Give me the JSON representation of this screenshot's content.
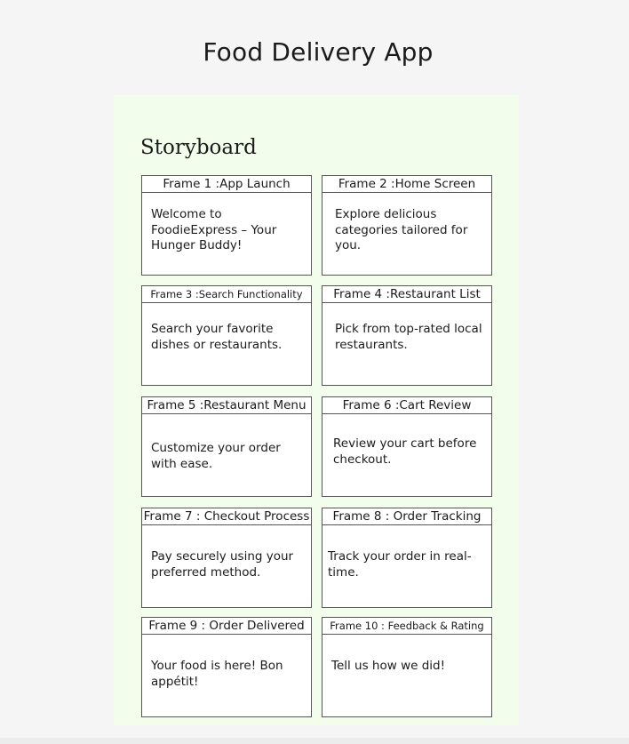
{
  "title": "Food Delivery App",
  "storyboard": {
    "heading": "Storyboard",
    "frames": [
      {
        "header": "Frame 1 :App Launch",
        "body": "Welcome to FoodieExpress – Your Hunger Buddy!"
      },
      {
        "header": "Frame 2 :Home Screen",
        "body": "Explore delicious categories tailored for you."
      },
      {
        "header": "Frame 3 :Search Functionality",
        "body": "Search your favorite dishes or restaurants."
      },
      {
        "header": "Frame 4 :Restaurant List",
        "body": "Pick from top-rated local restaurants."
      },
      {
        "header": "Frame 5 :Restaurant Menu",
        "body": "Customize your order with ease."
      },
      {
        "header": "Frame 6 :Cart Review",
        "body": "Review your cart before checkout."
      },
      {
        "header": "Frame 7 : Checkout Process",
        "body": "Pay securely using your preferred method."
      },
      {
        "header": "Frame 8 : Order Tracking",
        "body": "Track your order in real-time."
      },
      {
        "header": "Frame 9 : Order Delivered",
        "body": "Your food is here! Bon appétit!"
      },
      {
        "header": "Frame 10 : Feedback & Rating",
        "body": "Tell us how we did!"
      }
    ]
  },
  "colors": {
    "board_background": "#f2fdec",
    "page_background": "#f5f5f5",
    "border": "#555555"
  }
}
